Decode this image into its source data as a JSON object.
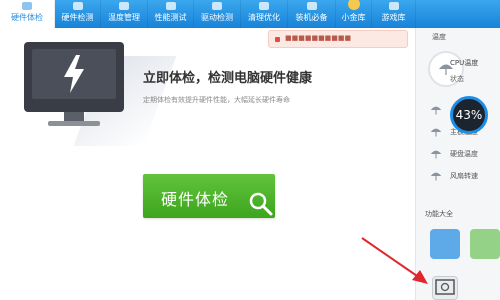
{
  "tabs": [
    {
      "label": "硬件体检",
      "active": true
    },
    {
      "label": "硬件检测"
    },
    {
      "label": "温度管理"
    },
    {
      "label": "性能测试"
    },
    {
      "label": "驱动检测"
    },
    {
      "label": "清理优化"
    },
    {
      "label": "装机必备"
    },
    {
      "label": "小金库"
    },
    {
      "label": "游戏库"
    }
  ],
  "notice": {
    "text": "■■■■■■■■■■"
  },
  "hero": {
    "title": "立即体检，检测电脑硬件健康",
    "subtitle": "定期体检有效提升硬件性能，大幅延长硬件寿命"
  },
  "check_button": {
    "label": "硬件体检"
  },
  "right_panel": {
    "header": "温度",
    "cpu_label": "CPU温度",
    "status_label": "状态",
    "temps": [
      {
        "label": ""
      },
      {
        "label": "主板温度"
      },
      {
        "label": "硬盘温度"
      },
      {
        "label": "风扇转速"
      }
    ],
    "percent": "43%",
    "tools_header": "功能大全"
  },
  "colors": {
    "accent": "#2b8ee3",
    "button_green": "#4db52a",
    "arrow_red": "#e0272e"
  }
}
